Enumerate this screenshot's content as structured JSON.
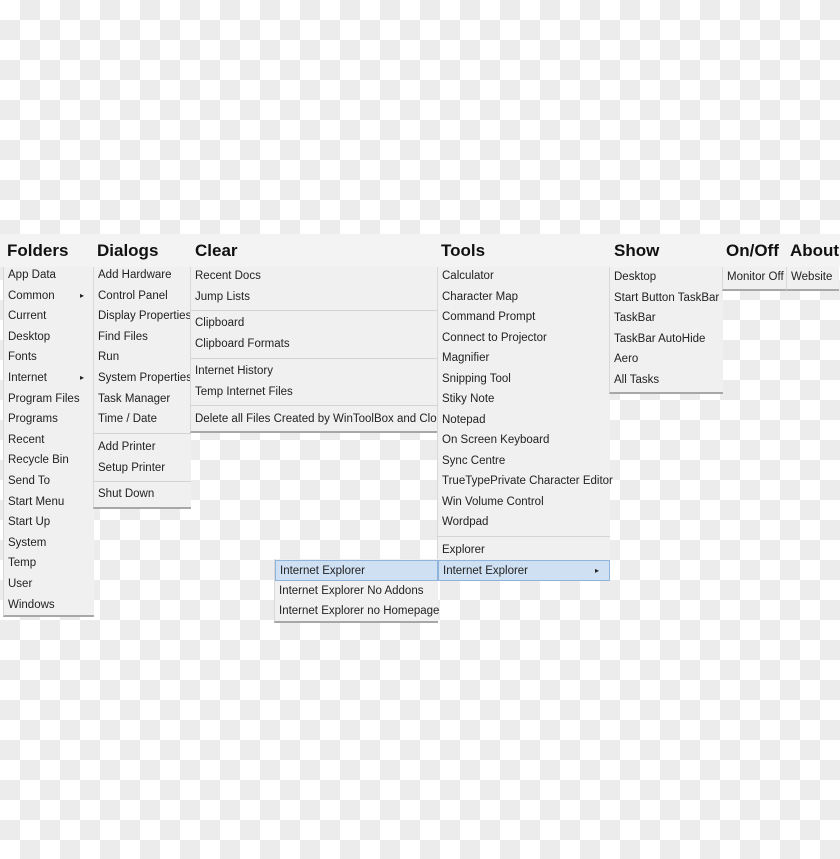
{
  "menubar": [
    "Folders",
    "Dialogs",
    "Clear",
    "Tools",
    "Show",
    "On/Off",
    "About"
  ],
  "folders": [
    "App Data",
    "Common",
    "Current",
    "Desktop",
    "Fonts",
    "Internet",
    "Program Files",
    "Programs",
    "Recent",
    "Recycle Bin",
    "Send To",
    "Start Menu",
    "Start Up",
    "System",
    "Temp",
    "User",
    "Windows"
  ],
  "dialogs": [
    "Add Hardware",
    "Control Panel",
    "Display Properties",
    "Find Files",
    "Run",
    "System Properties",
    "Task Manager",
    "Time / Date",
    "Add Printer",
    "Setup Printer",
    "Shut Down"
  ],
  "clear": [
    "Recent Docs",
    "Jump Lists",
    "Clipboard",
    "Clipboard Formats",
    "Internet History",
    "Temp Internet Files",
    "Delete all Files Created by WinToolBox and Close"
  ],
  "tools": [
    "Calculator",
    "Character Map",
    "Command Prompt",
    "Connect to Projector",
    "Magnifier",
    "Snipping Tool",
    "Stiky Note",
    "Notepad",
    "On Screen Keyboard",
    "Sync Centre",
    "TrueTypePrivate Character Editor",
    "Win Volume Control",
    "Wordpad",
    "Explorer",
    "Internet Explorer"
  ],
  "ie_submenu": [
    "Internet Explorer",
    "Internet Explorer No Addons",
    "Internet Explorer no Homepage"
  ],
  "show": [
    "Desktop",
    "Start Button  TaskBar",
    "TaskBar",
    "TaskBar AutoHide",
    "Aero",
    "All Tasks"
  ],
  "onoff": [
    "Monitor Off"
  ],
  "about": [
    "Website"
  ],
  "submenu_arrow": "▸",
  "highlight_color": "#cfe0f2"
}
